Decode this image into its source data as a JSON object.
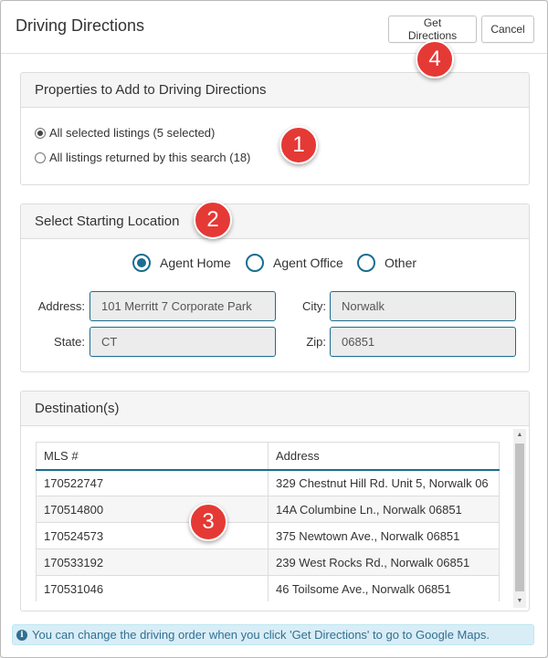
{
  "modal": {
    "title": "Driving Directions",
    "get_directions_label": "Get Directions",
    "cancel_label": "Cancel"
  },
  "badges": [
    "1",
    "2",
    "3",
    "4"
  ],
  "properties_panel": {
    "heading": "Properties to Add to Driving Directions",
    "options": [
      {
        "label": "All selected listings (5 selected)",
        "checked": true
      },
      {
        "label": "All listings returned by this search (18)",
        "checked": false
      }
    ]
  },
  "start_panel": {
    "heading": "Select Starting Location",
    "options": [
      {
        "label": "Agent Home",
        "checked": true
      },
      {
        "label": "Agent Office",
        "checked": false
      },
      {
        "label": "Other",
        "checked": false
      }
    ],
    "fields": {
      "address_label": "Address:",
      "address_value": "101 Merritt 7 Corporate Park",
      "city_label": "City:",
      "city_value": "Norwalk",
      "state_label": "State:",
      "state_value": "CT",
      "zip_label": "Zip:",
      "zip_value": "06851"
    }
  },
  "destinations_panel": {
    "heading": "Destination(s)",
    "columns": [
      "MLS #",
      "Address"
    ],
    "rows": [
      {
        "mls": "170522747",
        "address": "329 Chestnut Hill Rd. Unit 5, Norwalk 06"
      },
      {
        "mls": "170514800",
        "address": "14A Columbine Ln., Norwalk 06851"
      },
      {
        "mls": "170524573",
        "address": "375 Newtown Ave., Norwalk 06851"
      },
      {
        "mls": "170533192",
        "address": "239 West Rocks Rd., Norwalk 06851"
      },
      {
        "mls": "170531046",
        "address": "46 Toilsome Ave., Norwalk 06851"
      }
    ]
  },
  "info": {
    "icon": "info-icon",
    "text": "You can change the driving order when you click 'Get Directions' to go to Google Maps."
  },
  "colors": {
    "accent": "#1a6e91",
    "badge": "#e53935",
    "info_bg": "#d9edf7",
    "info_text": "#31708f"
  }
}
